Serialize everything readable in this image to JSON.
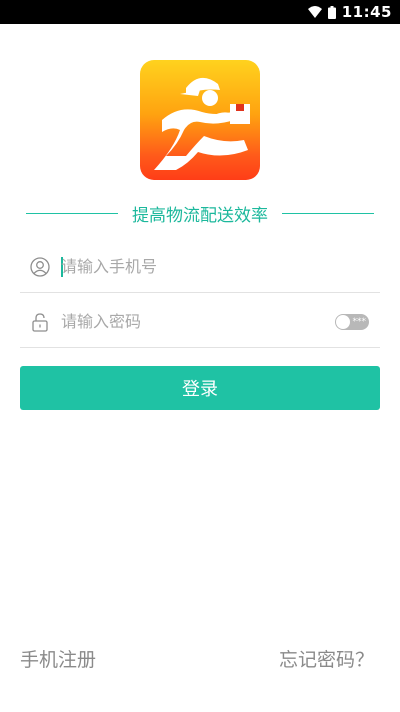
{
  "status_bar": {
    "time": "11:45",
    "wifi_icon": "wifi-icon",
    "battery_icon": "battery-icon"
  },
  "app": {
    "logo_icon": "delivery-courier-logo",
    "tagline": "提高物流配送效率"
  },
  "form": {
    "phone": {
      "placeholder": "请输入手机号",
      "value": "",
      "icon": "user-icon"
    },
    "password": {
      "placeholder": "请输入密码",
      "value": "",
      "icon": "lock-icon",
      "visibility_toggle": "off"
    },
    "login_button": "登录"
  },
  "footer": {
    "register_link": "手机注册",
    "forgot_link": "忘记密码？"
  },
  "colors": {
    "accent": "#1fc2a4",
    "accent_text": "#1cb89c",
    "logo_top": "#ffd21e",
    "logo_bottom": "#ff3d17"
  }
}
